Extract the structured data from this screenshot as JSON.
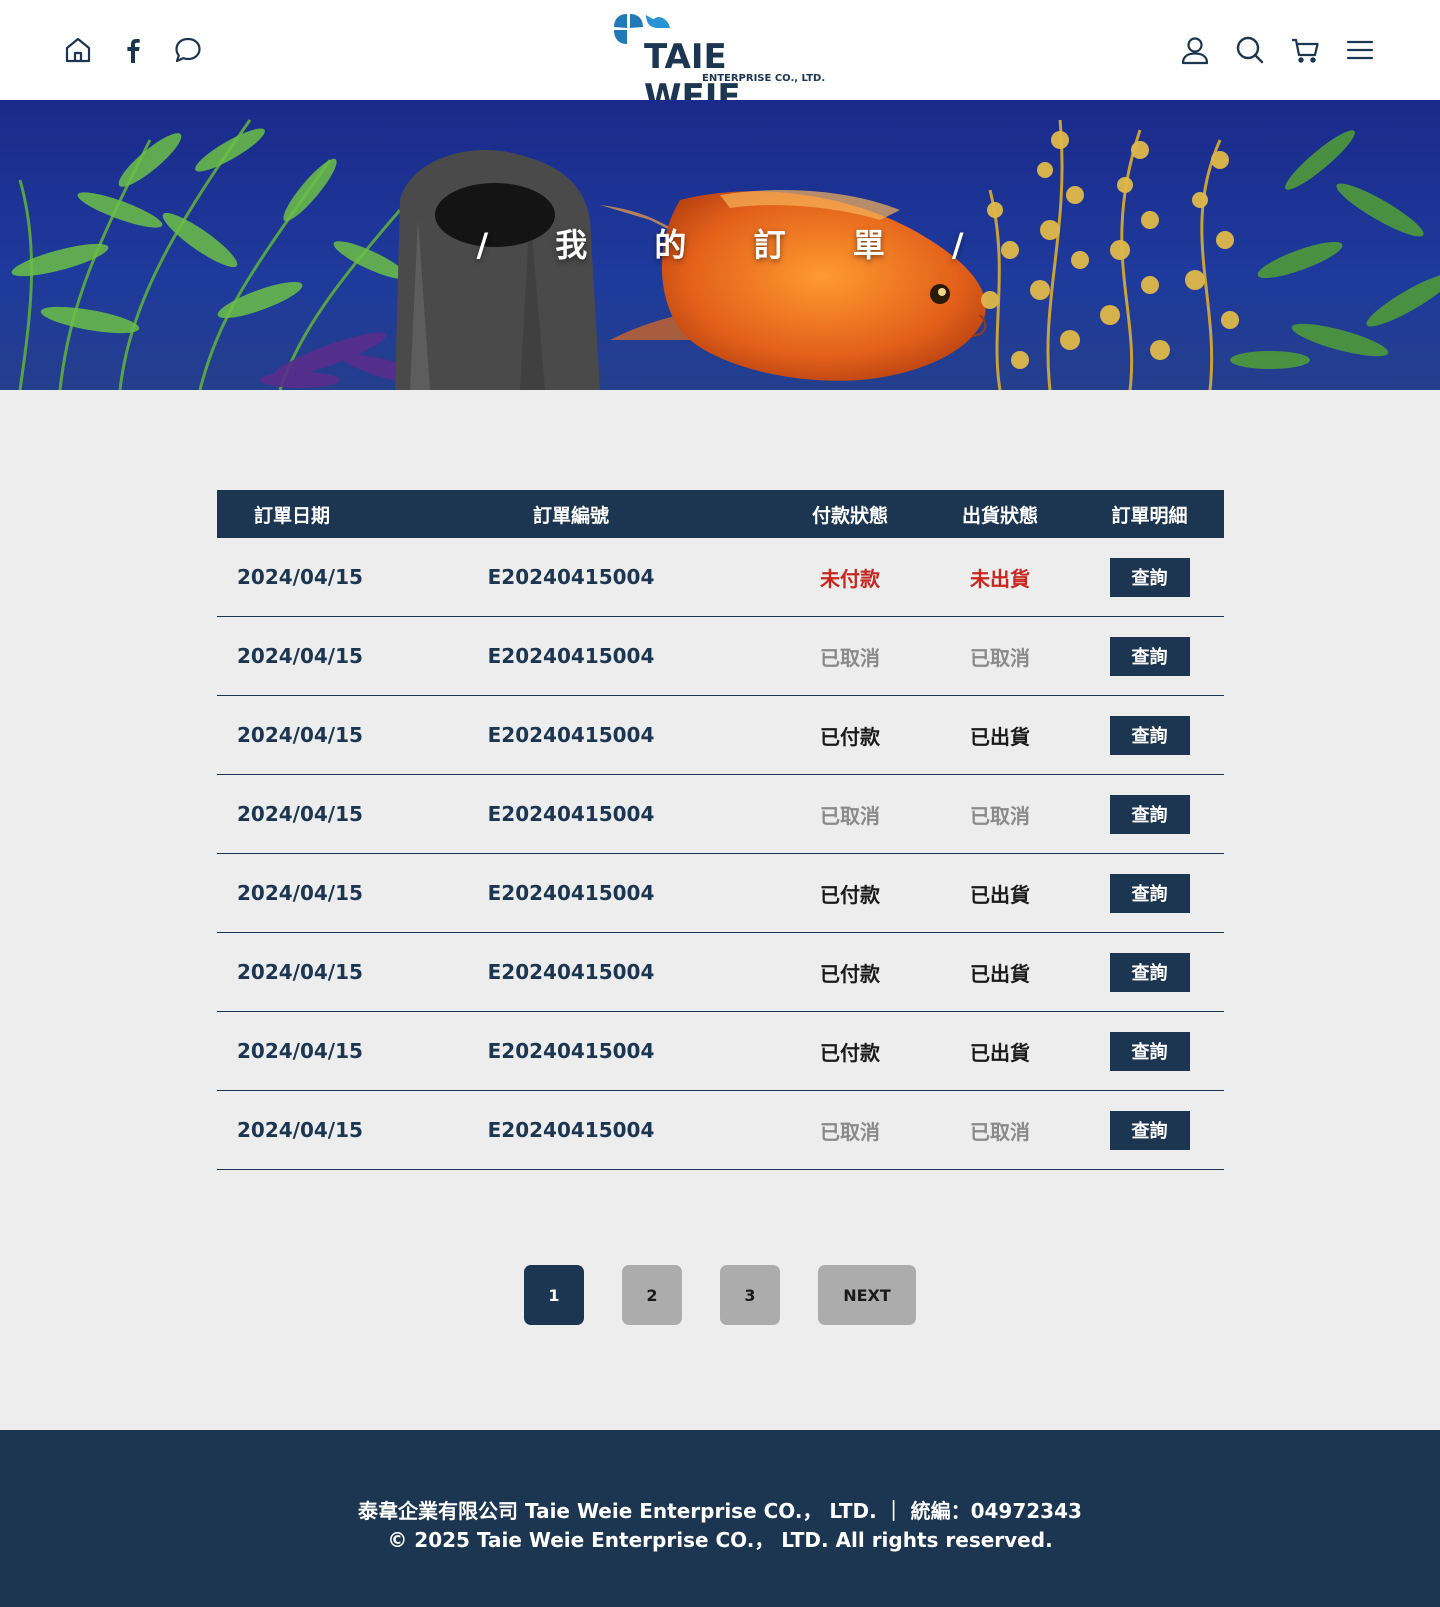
{
  "header": {
    "logo_text": "TAIE WEIE",
    "logo_subtitle": "ENTERPRISE CO., LTD.",
    "left_icons": [
      "home-icon",
      "facebook-icon",
      "chat-icon"
    ],
    "right_icons": [
      "user-icon",
      "search-icon",
      "cart-icon",
      "menu-icon"
    ]
  },
  "banner": {
    "title": "/ 我 的 訂 單 /"
  },
  "table": {
    "columns": [
      "訂單日期",
      "訂單編號",
      "付款狀態",
      "出貨狀態",
      "訂單明細"
    ],
    "rows": [
      {
        "date": "2024/04/15",
        "order_no": "E20240415004",
        "payment": "未付款",
        "shipping": "未出貨",
        "status": "unpaid",
        "action": "查詢"
      },
      {
        "date": "2024/04/15",
        "order_no": "E20240415004",
        "payment": "已取消",
        "shipping": "已取消",
        "status": "cancel",
        "action": "查詢"
      },
      {
        "date": "2024/04/15",
        "order_no": "E20240415004",
        "payment": "已付款",
        "shipping": "已出貨",
        "status": "done",
        "action": "查詢"
      },
      {
        "date": "2024/04/15",
        "order_no": "E20240415004",
        "payment": "已取消",
        "shipping": "已取消",
        "status": "cancel",
        "action": "查詢"
      },
      {
        "date": "2024/04/15",
        "order_no": "E20240415004",
        "payment": "已付款",
        "shipping": "已出貨",
        "status": "done",
        "action": "查詢"
      },
      {
        "date": "2024/04/15",
        "order_no": "E20240415004",
        "payment": "已付款",
        "shipping": "已出貨",
        "status": "done",
        "action": "查詢"
      },
      {
        "date": "2024/04/15",
        "order_no": "E20240415004",
        "payment": "已付款",
        "shipping": "已出貨",
        "status": "done",
        "action": "查詢"
      },
      {
        "date": "2024/04/15",
        "order_no": "E20240415004",
        "payment": "已取消",
        "shipping": "已取消",
        "status": "cancel",
        "action": "查詢"
      }
    ]
  },
  "pagination": {
    "pages": [
      "1",
      "2",
      "3"
    ],
    "current": "1",
    "next_label": "NEXT"
  },
  "footer": {
    "line1": "泰韋企業有限公司 Taie Weie Enterprise CO.， LTD. ｜ 統編：04972343",
    "line2": "© 2025 Taie Weie Enterprise CO.， LTD. All rights reserved."
  },
  "colors": {
    "primary": "#1c3550",
    "unpaid": "#c9261f",
    "cancelled": "#8a8a8a",
    "page_bg": "#ededed",
    "pager_inactive": "#acacac"
  }
}
